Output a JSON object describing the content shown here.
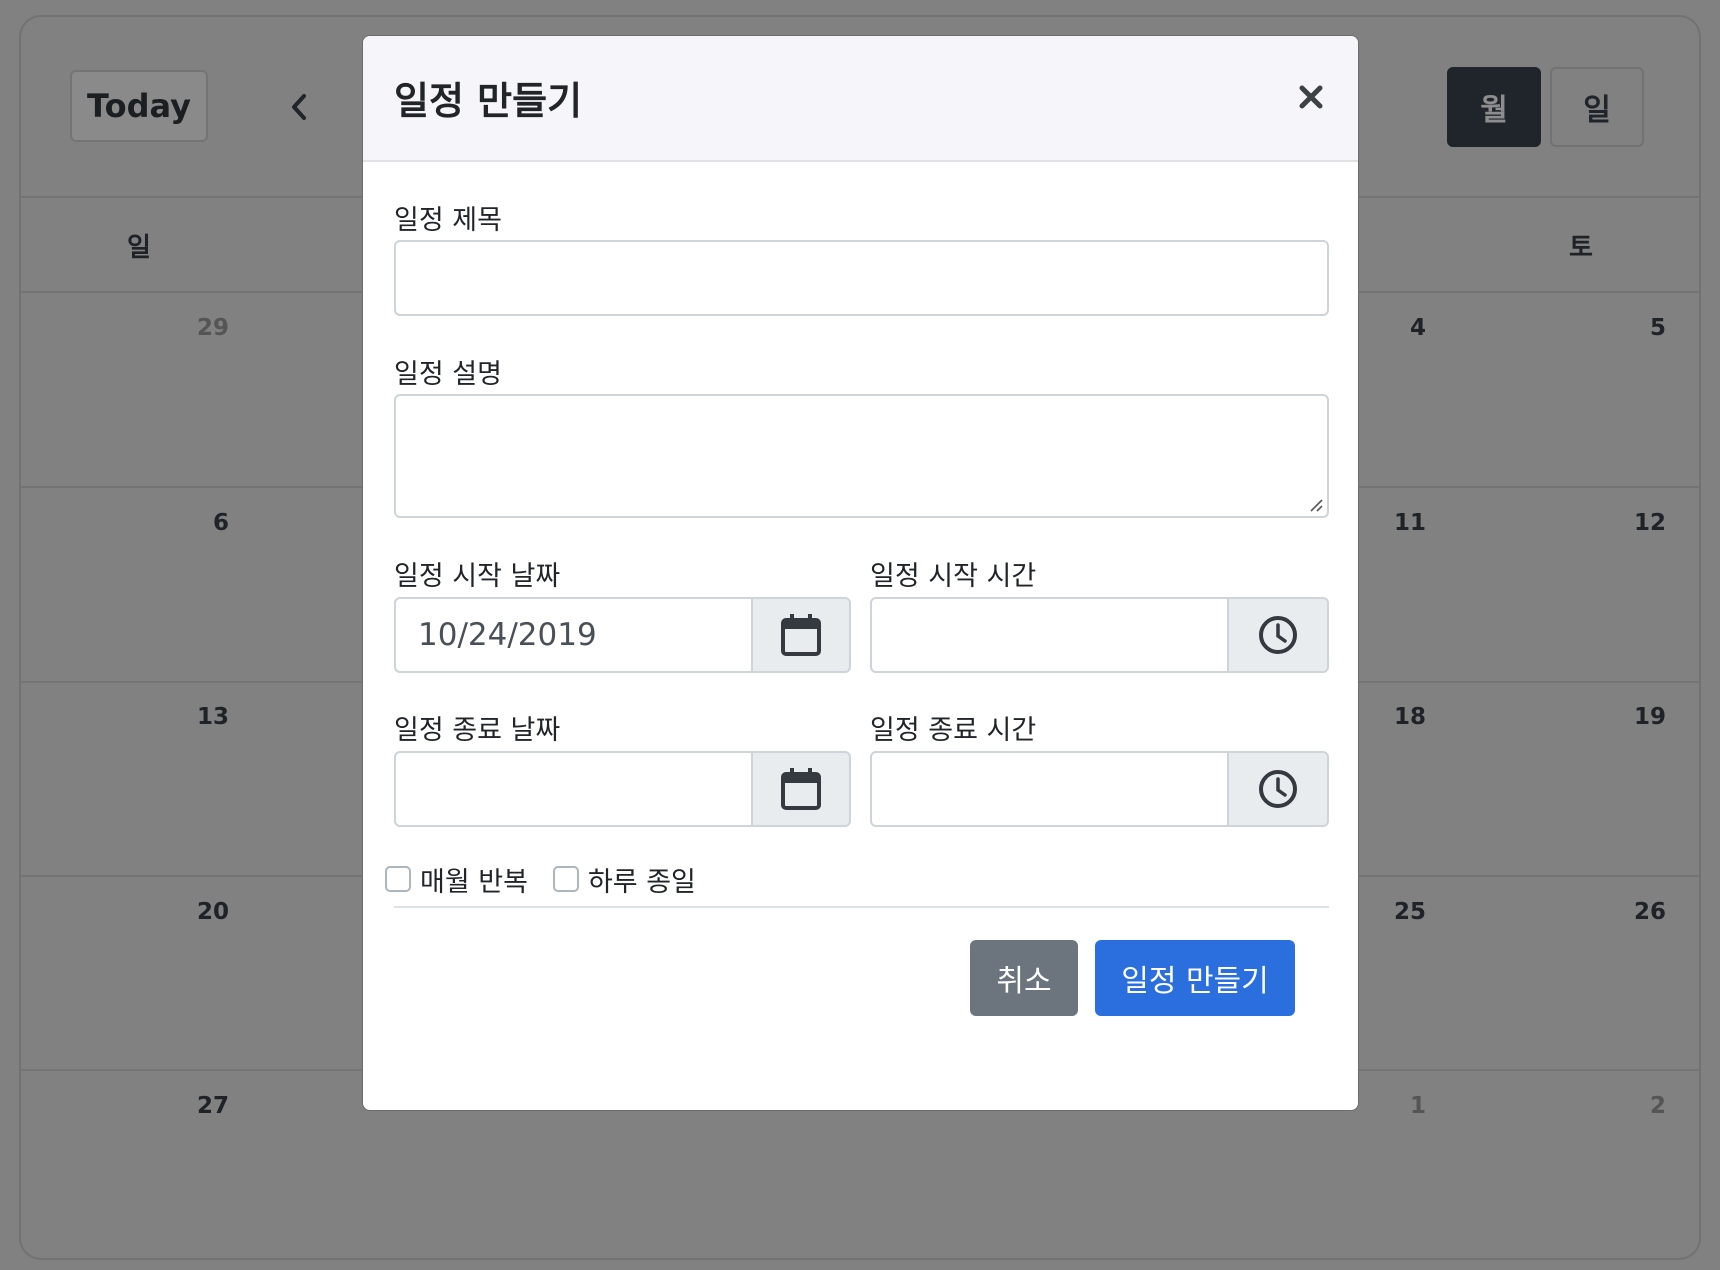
{
  "calendar": {
    "today_label": "Today",
    "view_buttons": {
      "month": "월",
      "day": "일"
    },
    "weekday_headers": {
      "sun": "일",
      "sat": "토"
    },
    "left_column_dates": [
      "29",
      "6",
      "13",
      "20",
      "27"
    ],
    "right_fri_dates": [
      "4",
      "11",
      "18",
      "25",
      "1"
    ],
    "right_sat_dates": [
      "5",
      "12",
      "19",
      "26",
      "2"
    ]
  },
  "modal": {
    "title": "일정 만들기",
    "fields": {
      "title_label": "일정 제목",
      "title_value": "",
      "description_label": "일정 설명",
      "description_value": "",
      "start_date_label": "일정 시작 날짜",
      "start_date_value": "10/24/2019",
      "start_time_label": "일정 시작 시간",
      "start_time_value": "",
      "end_date_label": "일정 종료 날짜",
      "end_date_value": "",
      "end_time_label": "일정 종료 시간",
      "end_time_value": ""
    },
    "options": {
      "repeat_monthly": "매월 반복",
      "all_day": "하루 종일"
    },
    "buttons": {
      "cancel": "취소",
      "create": "일정 만들기"
    }
  },
  "colors": {
    "primary": "#2b6fde",
    "secondary": "#6c757d",
    "overlay": "#818181",
    "dark_button": "#1f252a"
  },
  "icons": {
    "close": "close-icon",
    "calendar": "calendar-icon",
    "clock": "clock-icon",
    "prev": "chevron-left-icon"
  }
}
